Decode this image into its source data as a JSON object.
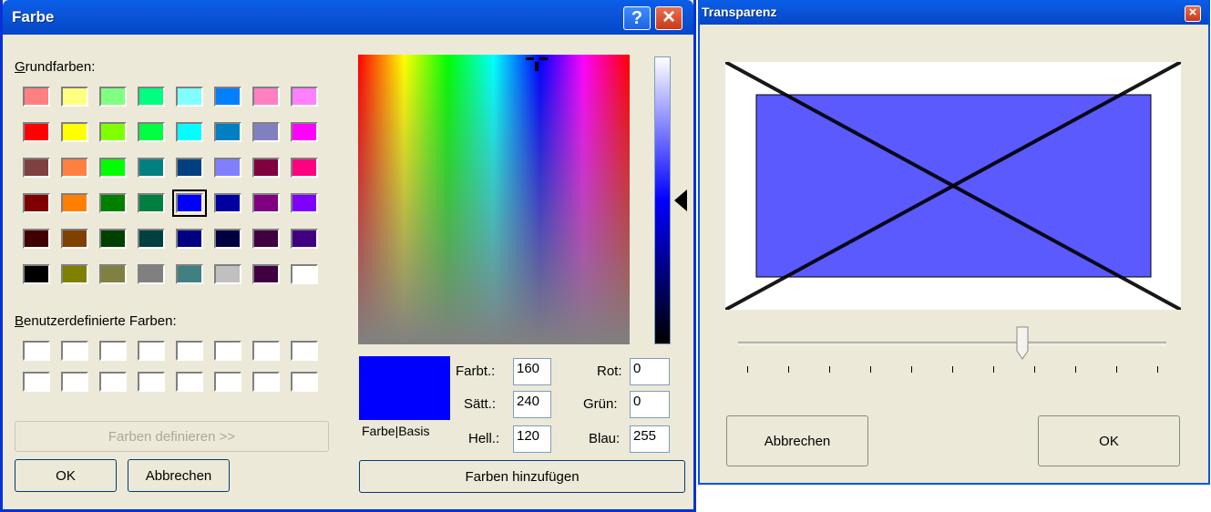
{
  "color_dialog": {
    "title": "Farbe",
    "basic_colors_label": "Grundfarben:",
    "basic_colors_mnemonic": "G",
    "basic_colors_rest": "rundfarben:",
    "basic_colors": [
      "#ff8080",
      "#ffff80",
      "#80ff80",
      "#00ff80",
      "#80ffff",
      "#0080ff",
      "#ff80c0",
      "#ff80ff",
      "#ff0000",
      "#ffff00",
      "#80ff00",
      "#00ff40",
      "#00ffff",
      "#0080c0",
      "#8080c0",
      "#ff00ff",
      "#804040",
      "#ff8040",
      "#00ff00",
      "#008080",
      "#004080",
      "#8080ff",
      "#800040",
      "#ff0080",
      "#800000",
      "#ff8000",
      "#008000",
      "#008040",
      "#0000ff",
      "#0000a0",
      "#800080",
      "#8000ff",
      "#400000",
      "#804000",
      "#004000",
      "#004040",
      "#000080",
      "#000040",
      "#400040",
      "#400080",
      "#000000",
      "#808000",
      "#808040",
      "#808080",
      "#408080",
      "#c0c0c0",
      "#400040",
      "#ffffff"
    ],
    "selected_basic_index": 28,
    "custom_colors_label": "Benutzerdefinierte Farben:",
    "custom_colors_mnemonic": "B",
    "custom_colors_rest": "enutzerdefinierte Farben:",
    "custom_colors": [
      "#ffffff",
      "#ffffff",
      "#ffffff",
      "#ffffff",
      "#ffffff",
      "#ffffff",
      "#ffffff",
      "#ffffff",
      "#ffffff",
      "#ffffff",
      "#ffffff",
      "#ffffff",
      "#ffffff",
      "#ffffff",
      "#ffffff",
      "#ffffff"
    ],
    "define_colors_label": "Farben definieren >>",
    "ok_label": "OK",
    "cancel_label": "Abbrechen",
    "preview_color": "#0000ff",
    "preview_label": "Farbe|Basis",
    "add_colors_label": "Farben hinzufügen",
    "hue_label": "Farbt.:",
    "sat_label": "Sätt.:",
    "lum_label": "Hell.:",
    "red_label": "Rot:",
    "green_label": "Grün:",
    "blue_label": "Blau:",
    "hue_value": "160",
    "sat_value": "240",
    "lum_value": "120",
    "red_value": "0",
    "green_value": "0",
    "blue_value": "255",
    "help_glyph": "?",
    "close_glyph": "×"
  },
  "transparency_dialog": {
    "title": "Transparenz",
    "preview_fill": "#5a5aff",
    "slider_fraction": 0.67,
    "tick_count": 11,
    "cancel_label": "Abbrechen",
    "ok_label": "OK",
    "close_glyph": "×"
  }
}
